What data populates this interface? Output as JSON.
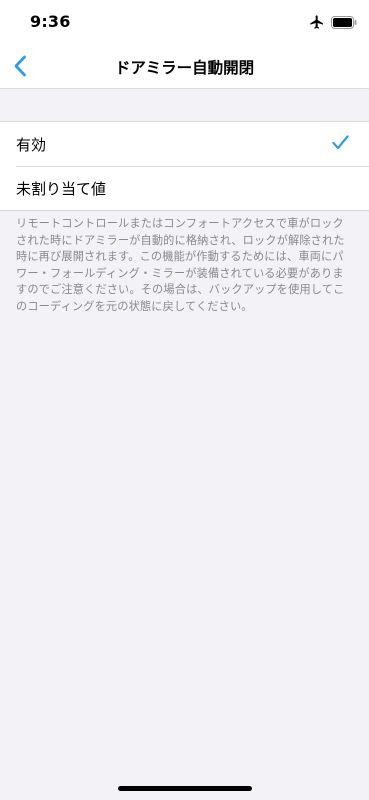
{
  "status_bar": {
    "time": "9:36",
    "icons": [
      "airplane-icon",
      "battery-icon"
    ]
  },
  "nav": {
    "title": "ドアミラー自動開閉",
    "back_icon": "chevron-left-icon"
  },
  "colors": {
    "accent": "#2f9ee0",
    "background": "#f2f2f7",
    "footer_text": "#8a8a8e"
  },
  "options": [
    {
      "label": "有効",
      "selected": true
    },
    {
      "label": "未割り当て値",
      "selected": false
    }
  ],
  "footer_note": "リモートコントロールまたはコンフォートアクセスで車がロックされた時にドアミラーが自動的に格納され、ロックが解除された時に再び展開されます。この機能が作動するためには、車両にパワー・フォールディング・ミラーが装備されている必要がありますのでご注意ください。その場合は、バックアップを使用してこのコーディングを元の状態に戻してください。"
}
